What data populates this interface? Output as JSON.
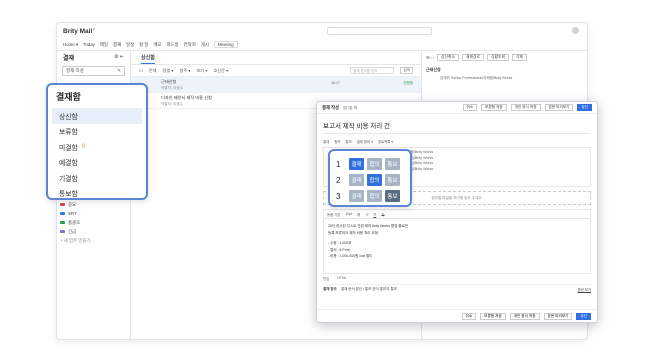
{
  "app": {
    "name": "Brity Mail",
    "beta": "β"
  },
  "menubar": {
    "items": [
      "Home ▾",
      "Today",
      "메일",
      "결재",
      "일정",
      "할 일",
      "메모",
      "피드방",
      "연락처",
      "게시"
    ],
    "meeting": "Meeting"
  },
  "sidebar": {
    "title": "결재",
    "compose_label": "결재 작성",
    "labels": [
      {
        "name": "중요",
        "color": "#e0474c"
      },
      {
        "name": "SRT",
        "color": "#2f7be0"
      },
      {
        "name": "총괄조",
        "color": "#2a9d59"
      },
      {
        "name": "긴급",
        "color": "#8e6bd6"
      }
    ],
    "new_label": "+ 새 범주 만들기"
  },
  "folder_popup": {
    "title": "결재함",
    "items": [
      {
        "label": "상신함",
        "count": "",
        "selected": true
      },
      {
        "label": "보류함",
        "count": "",
        "selected": false
      },
      {
        "label": "미결함",
        "count": "0",
        "selected": false
      },
      {
        "label": "예결함",
        "count": "",
        "selected": false
      },
      {
        "label": "기결함",
        "count": "",
        "selected": false
      },
      {
        "label": "통보함",
        "count": "",
        "selected": false
      }
    ]
  },
  "list": {
    "tab": "상신함",
    "toolbar": [
      "전체",
      "정렬 ▾",
      "범주 ▾",
      "보기 ▾",
      "호신문 ▾"
    ],
    "search_placeholder": "결재 문서명 검색",
    "search_button": "검색",
    "rows": [
      {
        "title": "근태신청",
        "sub": "작결자: 이광수",
        "date": "16:17",
        "status": "진행중"
      },
      {
        "title": "디자인 제안서 제작 비용 신청",
        "sub": "작결자: 이광수",
        "date": "",
        "status": ""
      }
    ]
  },
  "detail": {
    "toolbar": [
      "상신취소",
      "결재경로",
      "상황조회",
      "삭제"
    ],
    "title": "근태신청",
    "person": "김재리 Senior Professional/어제팀/Brity Works"
  },
  "compose": {
    "tab": "결재 작성",
    "top_buttons": [
      "취소",
      "보류함 저장",
      "개인 양식 저장",
      "본문 미리보기",
      "상신"
    ],
    "title": "보고서 제작 비용 처리 건",
    "flow_tabs": [
      "결재",
      "합의",
      "통보",
      "결재 형태 ▾",
      "경로목록 ▾"
    ],
    "flow_lines": [
      "어제팀/Brity Works",
      "어제팀/Brity Works",
      "그룹팀/Brity Works",
      "어제팀/Brity Works"
    ],
    "attach_text": "첨부할 파일을 여기에 놓아 주세요.",
    "editor_tools": [
      "돋움 기본",
      "10pt",
      "가",
      "가",
      "가",
      "가"
    ],
    "body_lines": [
      "20년 한시된 디스트 관련 제작 Brity Works 협업 플로안",
      "등록 보류되어 제작 비용 처리 요청",
      "",
      "- 수량 : 1,000부",
      "- 컬러 : 5 Print",
      "- 비용 : 1,000,000원 /vat 별도"
    ],
    "editor_tabs": [
      "편집",
      "HTML"
    ],
    "ref_label": "결재 참조",
    "ref_value": "결재 문서 발신 / 통보 방식 통보지 통보",
    "ref_link": "옵션 보기",
    "bottom_buttons": [
      "취소",
      "보류함 저장",
      "개인 양식 저장",
      "본문 미리보기",
      "상신"
    ]
  },
  "line_popup": {
    "rows": [
      {
        "num": "1",
        "chips": [
          {
            "label": "결재",
            "color": "#2f6fe0"
          },
          {
            "label": "합의",
            "color": "#a7b3c7"
          },
          {
            "label": "통보",
            "color": "#a7b3c7"
          }
        ]
      },
      {
        "num": "2",
        "chips": [
          {
            "label": "결재",
            "color": "#a7b3c7"
          },
          {
            "label": "합의",
            "color": "#2f6fe0"
          },
          {
            "label": "통보",
            "color": "#a7b3c7"
          }
        ]
      },
      {
        "num": "3",
        "chips": [
          {
            "label": "결재",
            "color": "#a7b3c7"
          },
          {
            "label": "합의",
            "color": "#a7b3c7"
          },
          {
            "label": "통보",
            "color": "#5a6b84"
          }
        ]
      }
    ]
  }
}
